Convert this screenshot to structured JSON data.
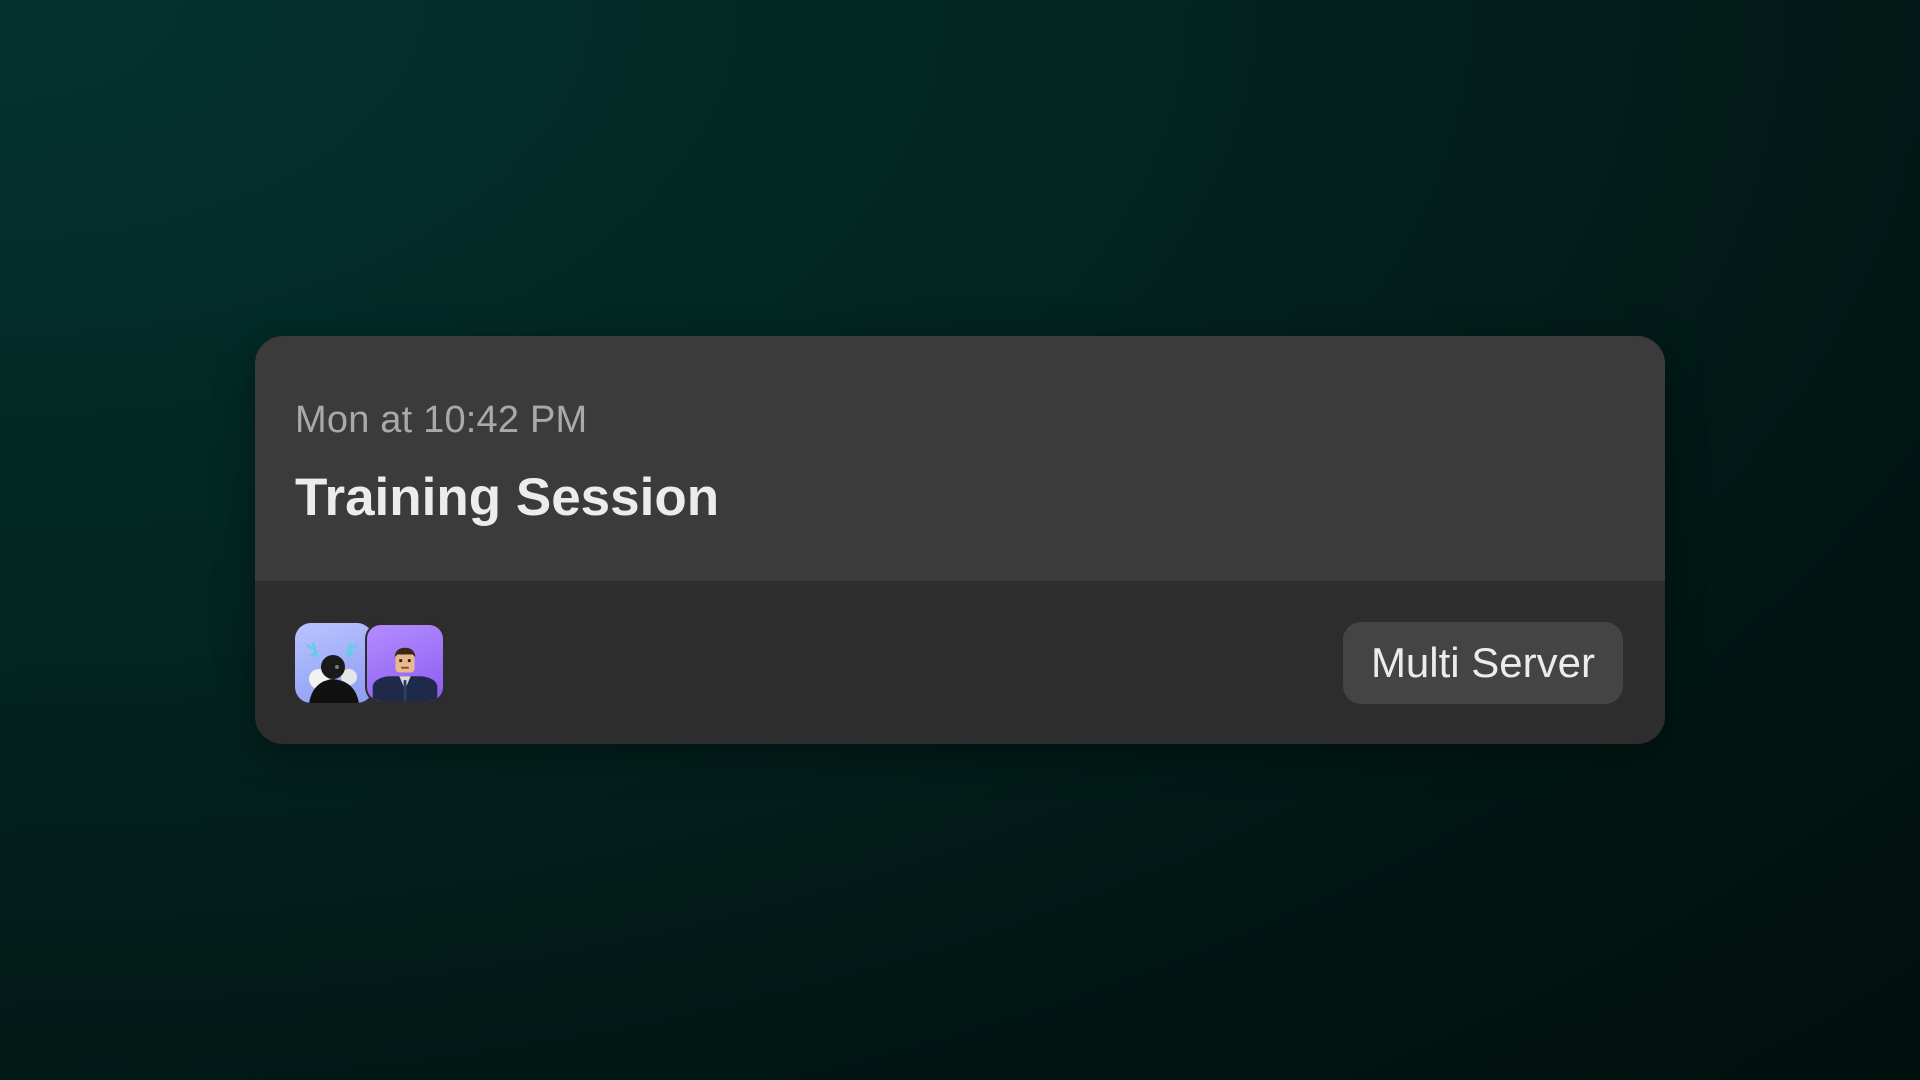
{
  "event_card": {
    "timestamp": "Mon at 10:42 PM",
    "title": "Training Session",
    "participants": [
      {
        "avatar_icon": "avatar-dark-antlered-character"
      },
      {
        "avatar_icon": "avatar-suited-character"
      }
    ],
    "server_badge": "Multi Server"
  },
  "colors": {
    "card_top": "#3b3b3b",
    "card_bottom": "#2d2d2d",
    "badge_bg": "#444444"
  }
}
